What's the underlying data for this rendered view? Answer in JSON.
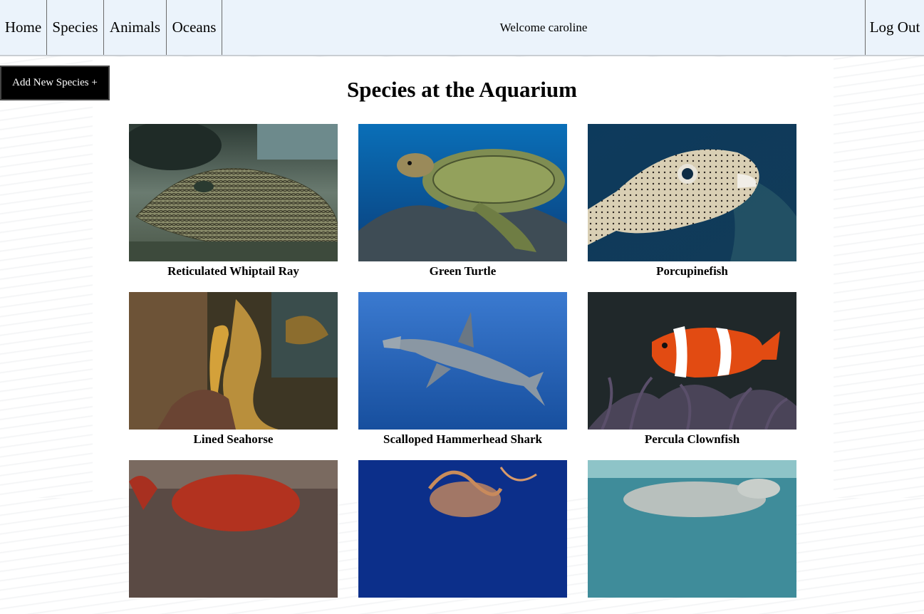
{
  "nav": {
    "home": "Home",
    "species": "Species",
    "animals": "Animals",
    "oceans": "Oceans",
    "welcome": "Welcome caroline",
    "logout": "Log Out"
  },
  "actions": {
    "add_species": "Add New Species +"
  },
  "page": {
    "title": "Species at the Aquarium"
  },
  "species": [
    {
      "name": "Reticulated Whiptail Ray"
    },
    {
      "name": "Green Turtle"
    },
    {
      "name": "Porcupinefish"
    },
    {
      "name": "Lined Seahorse"
    },
    {
      "name": "Scalloped Hammerhead Shark"
    },
    {
      "name": "Percula Clownfish"
    },
    {
      "name": ""
    },
    {
      "name": ""
    },
    {
      "name": ""
    }
  ]
}
